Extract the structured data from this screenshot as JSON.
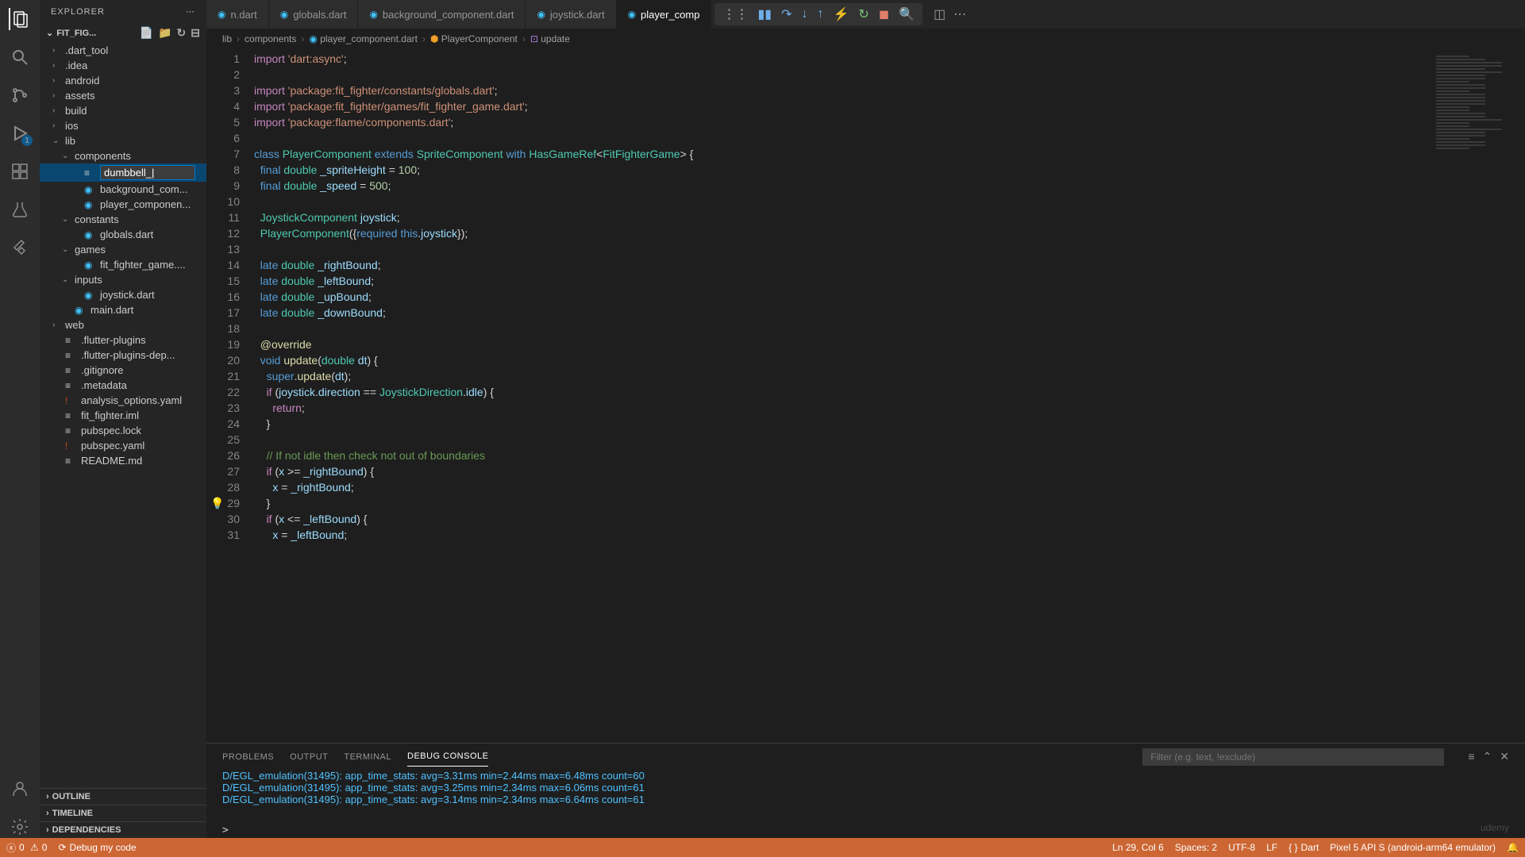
{
  "sidebar": {
    "title": "EXPLORER",
    "project": "FIT_FIG...",
    "tree": [
      {
        "label": ".dart_tool",
        "type": "folder",
        "indent": 1
      },
      {
        "label": ".idea",
        "type": "folder",
        "indent": 1
      },
      {
        "label": "android",
        "type": "folder",
        "indent": 1
      },
      {
        "label": "assets",
        "type": "folder",
        "indent": 1
      },
      {
        "label": "build",
        "type": "folder",
        "indent": 1
      },
      {
        "label": "ios",
        "type": "folder",
        "indent": 1
      },
      {
        "label": "lib",
        "type": "folder-open",
        "indent": 1
      },
      {
        "label": "components",
        "type": "folder-open",
        "indent": 2
      },
      {
        "label": "dumbbell_|",
        "type": "editing",
        "indent": 3
      },
      {
        "label": "background_com...",
        "type": "dart",
        "indent": 3
      },
      {
        "label": "player_componen...",
        "type": "dart",
        "indent": 3
      },
      {
        "label": "constants",
        "type": "folder-open",
        "indent": 2
      },
      {
        "label": "globals.dart",
        "type": "dart",
        "indent": 3
      },
      {
        "label": "games",
        "type": "folder-open",
        "indent": 2
      },
      {
        "label": "fit_fighter_game....",
        "type": "dart",
        "indent": 3
      },
      {
        "label": "inputs",
        "type": "folder-open",
        "indent": 2
      },
      {
        "label": "joystick.dart",
        "type": "dart",
        "indent": 3
      },
      {
        "label": "main.dart",
        "type": "dart",
        "indent": 2
      },
      {
        "label": "web",
        "type": "folder",
        "indent": 1
      },
      {
        "label": ".flutter-plugins",
        "type": "file",
        "indent": 1
      },
      {
        "label": ".flutter-plugins-dep...",
        "type": "file",
        "indent": 1
      },
      {
        "label": ".gitignore",
        "type": "file",
        "indent": 1
      },
      {
        "label": ".metadata",
        "type": "file",
        "indent": 1
      },
      {
        "label": "analysis_options.yaml",
        "type": "yaml",
        "indent": 1
      },
      {
        "label": "fit_fighter.iml",
        "type": "file",
        "indent": 1
      },
      {
        "label": "pubspec.lock",
        "type": "file",
        "indent": 1
      },
      {
        "label": "pubspec.yaml",
        "type": "yaml",
        "indent": 1
      },
      {
        "label": "README.md",
        "type": "file",
        "indent": 1
      }
    ],
    "collapsed": [
      "OUTLINE",
      "TIMELINE",
      "DEPENDENCIES"
    ]
  },
  "tabs": [
    {
      "label": "n.dart"
    },
    {
      "label": "globals.dart"
    },
    {
      "label": "background_component.dart"
    },
    {
      "label": "joystick.dart"
    },
    {
      "label": "player_comp",
      "active": true
    }
  ],
  "breadcrumb": [
    "lib",
    "components",
    "player_component.dart",
    "PlayerComponent",
    "update"
  ],
  "code_lines": [
    {
      "n": 1,
      "html": "<span class='kw2'>import</span> <span class='str'>'dart:async'</span><span class='punc'>;</span>"
    },
    {
      "n": 2,
      "html": ""
    },
    {
      "n": 3,
      "html": "<span class='kw2'>import</span> <span class='str'>'package:fit_fighter/constants/globals.dart'</span><span class='punc'>;</span>"
    },
    {
      "n": 4,
      "html": "<span class='kw2'>import</span> <span class='str'>'package:fit_fighter/games/fit_fighter_game.dart'</span><span class='punc'>;</span>"
    },
    {
      "n": 5,
      "html": "<span class='kw2'>import</span> <span class='str'>'package:flame/components.dart'</span><span class='punc'>;</span>"
    },
    {
      "n": 6,
      "html": ""
    },
    {
      "n": 7,
      "html": "<span class='kw'>class</span> <span class='type'>PlayerComponent</span> <span class='kw'>extends</span> <span class='type'>SpriteComponent</span> <span class='kw'>with</span> <span class='type'>HasGameRef</span><span class='punc'>&lt;</span><span class='type'>FitFighterGame</span><span class='punc'>&gt; {</span>"
    },
    {
      "n": 8,
      "html": "  <span class='kw'>final</span> <span class='type'>double</span> <span class='prop'>_spriteHeight</span> <span class='op'>=</span> <span class='num'>100</span><span class='punc'>;</span>"
    },
    {
      "n": 9,
      "html": "  <span class='kw'>final</span> <span class='type'>double</span> <span class='prop'>_speed</span> <span class='op'>=</span> <span class='num'>500</span><span class='punc'>;</span>"
    },
    {
      "n": 10,
      "html": ""
    },
    {
      "n": 11,
      "html": "  <span class='type'>JoystickComponent</span> <span class='prop'>joystick</span><span class='punc'>;</span>"
    },
    {
      "n": 12,
      "html": "  <span class='type'>PlayerComponent</span><span class='punc'>({</span><span class='kw'>required</span> <span class='kw'>this</span><span class='punc'>.</span><span class='prop'>joystick</span><span class='punc'>});</span>"
    },
    {
      "n": 13,
      "html": ""
    },
    {
      "n": 14,
      "html": "  <span class='kw'>late</span> <span class='type'>double</span> <span class='prop'>_rightBound</span><span class='punc'>;</span>"
    },
    {
      "n": 15,
      "html": "  <span class='kw'>late</span> <span class='type'>double</span> <span class='prop'>_leftBound</span><span class='punc'>;</span>"
    },
    {
      "n": 16,
      "html": "  <span class='kw'>late</span> <span class='type'>double</span> <span class='prop'>_upBound</span><span class='punc'>;</span>"
    },
    {
      "n": 17,
      "html": "  <span class='kw'>late</span> <span class='type'>double</span> <span class='prop'>_downBound</span><span class='punc'>;</span>"
    },
    {
      "n": 18,
      "html": ""
    },
    {
      "n": 19,
      "html": "  <span class='ann'>@override</span>"
    },
    {
      "n": 20,
      "html": "  <span class='kw'>void</span> <span class='fn'>update</span><span class='punc'>(</span><span class='type'>double</span> <span class='prop'>dt</span><span class='punc'>) {</span>"
    },
    {
      "n": 21,
      "html": "    <span class='kw'>super</span><span class='punc'>.</span><span class='fn'>update</span><span class='punc'>(</span><span class='prop'>dt</span><span class='punc'>);</span>"
    },
    {
      "n": 22,
      "html": "    <span class='kw2'>if</span> <span class='punc'>(</span><span class='prop'>joystick</span><span class='punc'>.</span><span class='prop'>direction</span> <span class='op'>==</span> <span class='type'>JoystickDirection</span><span class='punc'>.</span><span class='prop'>idle</span><span class='punc'>) {</span>"
    },
    {
      "n": 23,
      "html": "      <span class='kw2'>return</span><span class='punc'>;</span>"
    },
    {
      "n": 24,
      "html": "    <span class='punc'>}</span>"
    },
    {
      "n": 25,
      "html": ""
    },
    {
      "n": 26,
      "html": "    <span class='cmt'>// If not idle then check not out of boundaries</span>"
    },
    {
      "n": 27,
      "html": "    <span class='kw2'>if</span> <span class='punc'>(</span><span class='prop'>x</span> <span class='op'>&gt;=</span> <span class='prop'>_rightBound</span><span class='punc'>) {</span>"
    },
    {
      "n": 28,
      "html": "      <span class='prop'>x</span> <span class='op'>=</span> <span class='prop'>_rightBound</span><span class='punc'>;</span>"
    },
    {
      "n": 29,
      "html": "    <span class='punc'>}</span>",
      "bulb": true
    },
    {
      "n": 30,
      "html": "    <span class='kw2'>if</span> <span class='punc'>(</span><span class='prop'>x</span> <span class='op'>&lt;=</span> <span class='prop'>_leftBound</span><span class='punc'>) {</span>"
    },
    {
      "n": 31,
      "html": "      <span class='prop'>x</span> <span class='op'>=</span> <span class='prop'>_leftBound</span><span class='punc'>;</span>"
    }
  ],
  "panel": {
    "tabs": [
      "PROBLEMS",
      "OUTPUT",
      "TERMINAL",
      "DEBUG CONSOLE"
    ],
    "active_tab": 3,
    "filter_placeholder": "Filter (e.g. text, !exclude)",
    "logs": [
      "D/EGL_emulation(31495): app_time_stats: avg=3.31ms min=2.44ms max=6.48ms count=60",
      "D/EGL_emulation(31495): app_time_stats: avg=3.25ms min=2.34ms max=6.06ms count=61",
      "D/EGL_emulation(31495): app_time_stats: avg=3.14ms min=2.34ms max=6.64ms count=61"
    ],
    "prompt": ">"
  },
  "statusbar": {
    "errors": "0",
    "warnings": "0",
    "debug_btn": "Debug my code",
    "cursor": "Ln 29, Col 6",
    "spaces": "Spaces: 2",
    "encoding": "UTF-8",
    "eol": "LF",
    "lang": "Dart",
    "device": "Pixel 5 API S (android-arm64 emulator)"
  }
}
